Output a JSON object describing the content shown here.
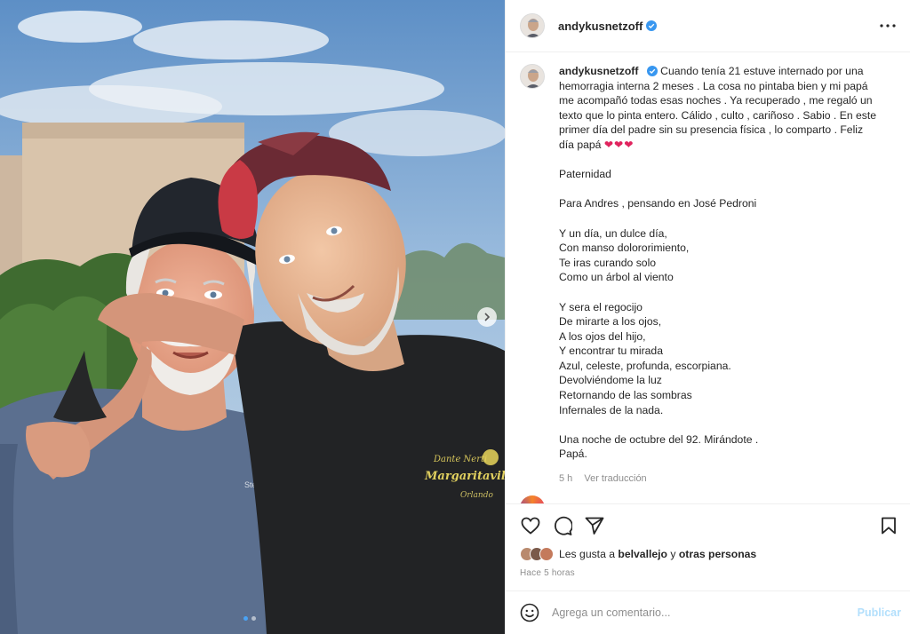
{
  "post": {
    "username": "andykusnetzoff",
    "verified_icon": "verified-badge-icon",
    "more_icon": "more-options-icon"
  },
  "photo": {
    "carousel_total": 2,
    "carousel_current": 1,
    "next_icon": "chevron-right-icon",
    "shirt_print_line1": "Dante Nerti",
    "shirt_print_line2": "Margaritaville",
    "shirt_print_line3": "Orlando",
    "shirt_left": "Ste"
  },
  "caption": {
    "username": "andykusnetzoff",
    "intro": "Cuando tenía 21 estuve internado por una hemorragia interna 2 meses . La cosa no pintaba bien y mi papá me acompañó todas esas noches . Ya recuperado , me regaló un texto que lo pinta entero. Cálido , culto , cariñoso . Sabio . En este primer día del padre sin su presencia física , lo comparto . Feliz día papá",
    "hearts": "❤❤❤",
    "title": "Paternidad",
    "dedication": "Para Andres , pensando en José Pedroni",
    "stanza1": "Y un día, un dulce día,\nCon manso dolororimiento,\nTe iras curando solo\nComo un árbol al viento",
    "stanza2": "Y sera el regocijo\nDe mirarte a los ojos,\nA los ojos del hijo,\nY encontrar tu mirada\nAzul, celeste, profunda, escorpiana.\nDevolviéndome la luz\nRetornando de las sombras\nInfernales de la nada.",
    "closing": "Una noche de octubre del 92. Mirándote .\nPapá.",
    "time": "5 h",
    "translate": "Ver traducción"
  },
  "actions": {
    "like_icon": "heart-icon",
    "comment_icon": "comment-icon",
    "share_icon": "send-icon",
    "save_icon": "bookmark-icon"
  },
  "likes": {
    "prefix": "Les gusta a",
    "user": "belvallejo",
    "connector": "y",
    "others": "otras personas"
  },
  "time_ago": "Hace 5 horas",
  "comment": {
    "emoji_icon": "emoji-icon",
    "placeholder": "Agrega un comentario...",
    "publish": "Publicar"
  },
  "colors": {
    "accent": "#0095f6",
    "publish_disabled": "#b2dffc",
    "verified": "#3897f0",
    "heart": "#e0245e",
    "muted": "#8e8e8e"
  }
}
